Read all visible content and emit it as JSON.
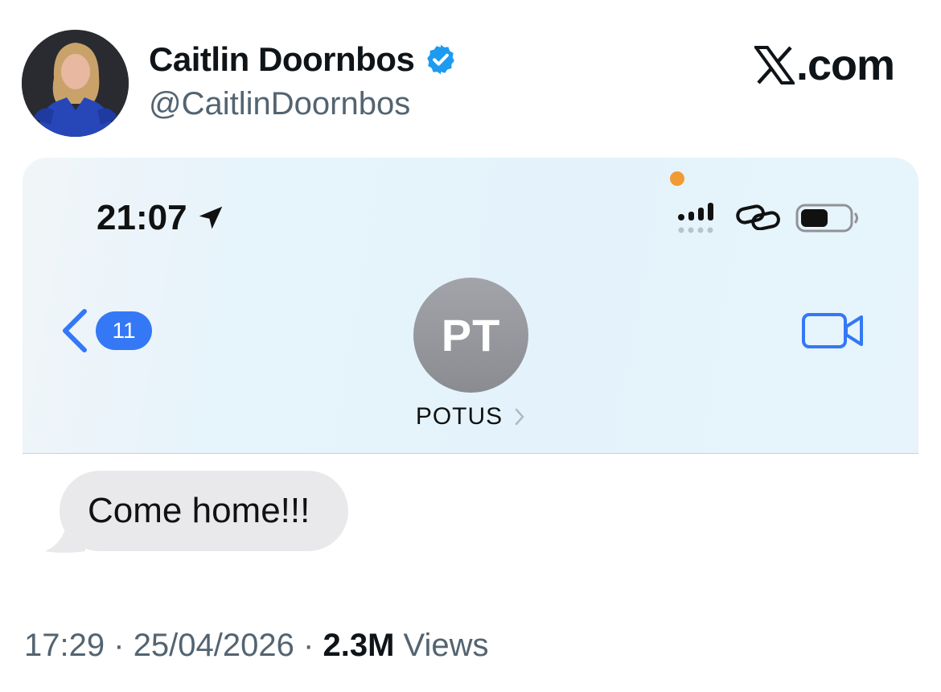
{
  "tweet": {
    "display_name": "Caitlin Doornbos",
    "handle": "@CaitlinDoornbos",
    "brand": ".com",
    "time": "17:29",
    "date": "25/04/2026",
    "views_count": "2.3M",
    "views_label": "Views",
    "separator": "·"
  },
  "phone": {
    "status_time": "21:07",
    "back_badge": "11",
    "contact_initials": "PT",
    "contact_name": "POTUS",
    "message": "Come home!!!"
  },
  "colors": {
    "ios_blue": "#3478f6",
    "verified_blue": "#1d9bf0",
    "muted_text": "#536471",
    "bubble_gray": "#e9e9eb",
    "mic_indicator": "#f29a33"
  },
  "icons": {
    "verified": "verified-badge-icon",
    "brand": "x-logo-icon",
    "location": "location-arrow-icon",
    "signal": "cellular-signal-icon",
    "link": "link-icon",
    "battery": "battery-icon",
    "back": "chevron-left-icon",
    "video": "video-camera-icon",
    "contact_detail": "chevron-right-icon"
  }
}
